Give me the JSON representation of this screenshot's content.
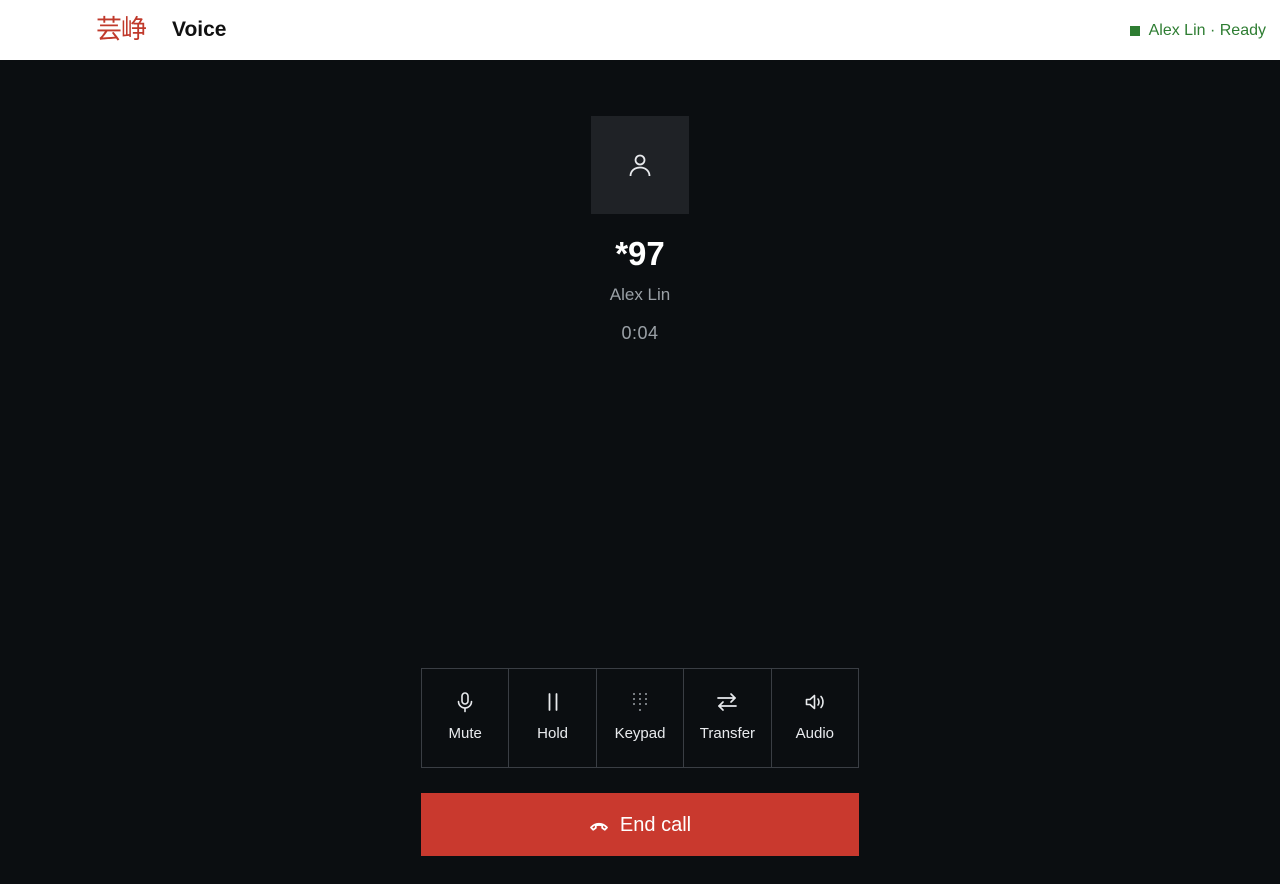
{
  "header": {
    "logo_text": "芸峥",
    "app_name": "Voice",
    "status_text": "Alex Lin · Ready",
    "status_color": "#2e7d32"
  },
  "call": {
    "number": "*97",
    "name": "Alex Lin",
    "timer": "0:04"
  },
  "controls": [
    {
      "label": "Mute",
      "icon": "microphone-icon"
    },
    {
      "label": "Hold",
      "icon": "pause-icon"
    },
    {
      "label": "Keypad",
      "icon": "keypad-icon"
    },
    {
      "label": "Transfer",
      "icon": "transfer-icon"
    },
    {
      "label": "Audio",
      "icon": "speaker-icon"
    }
  ],
  "end_call": {
    "label": "End call",
    "color": "#c9392e"
  }
}
